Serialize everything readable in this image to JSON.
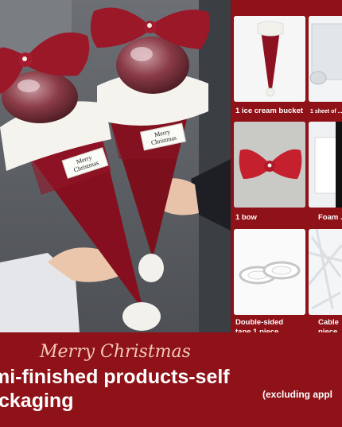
{
  "photo": {
    "tag_left": "Merry Christmas",
    "tag_right": "Merry Christmas"
  },
  "items": [
    {
      "caption": "1 ice cream bucket",
      "icon": "ice-cream-bucket"
    },
    {
      "caption": "1 sheet of ...",
      "icon": "transparent-film-roll"
    },
    {
      "caption": "1 bow",
      "icon": "red-bow"
    },
    {
      "caption": "Foam ...",
      "icon": "foam-roll"
    },
    {
      "caption_lines": [
        "Double-sided",
        "tape 1 piece"
      ],
      "icon": "double-sided-tape"
    },
    {
      "caption_lines": [
        "Cable",
        "piece"
      ],
      "icon": "cable-ties"
    }
  ],
  "banner": {
    "greeting": "Merry Christmas",
    "title_line1": "mi-finished products-self",
    "title_line2": "ckaging",
    "note": "(excluding appl"
  },
  "colors": {
    "background": "#8e1218",
    "greeting": "#f2c9b8",
    "knit_red": "#8a1020"
  }
}
